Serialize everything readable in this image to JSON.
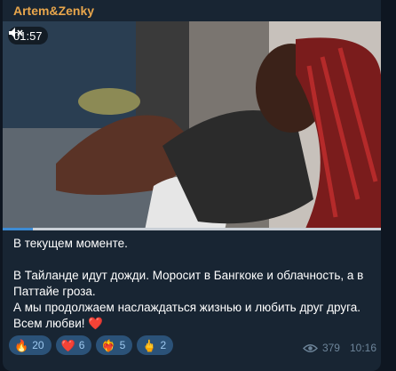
{
  "channel": {
    "author": "Artem&Zenky"
  },
  "video": {
    "duration": "01:57",
    "muted_icon": "mute-icon",
    "progress": 0.08
  },
  "message": {
    "lines": [
      "В текущем моменте.",
      "В Тайланде идут дожди. Моросит в Бангкоке и облачность, а в Паттайе гроза.",
      "А мы продолжаем наслаждаться жизнью и любить друг друга.",
      "Всем любви!"
    ],
    "heart": "❤️"
  },
  "reactions": [
    {
      "emoji": "🔥",
      "icon": "fire-icon",
      "count": "20"
    },
    {
      "emoji": "❤️",
      "icon": "heart-icon",
      "count": "6"
    },
    {
      "emoji": "❤️‍🔥",
      "icon": "heart-on-fire-icon",
      "count": "5"
    },
    {
      "emoji": "🖕",
      "icon": "finger-icon",
      "count": "2"
    }
  ],
  "meta": {
    "views": "379",
    "time": "10:16"
  },
  "colors": {
    "background": "#0e1621",
    "bubble": "#182533",
    "author": "#e8a64c",
    "reaction_bg": "#2b5278",
    "reaction_text": "#9ec9f0",
    "meta": "#6d8499"
  }
}
